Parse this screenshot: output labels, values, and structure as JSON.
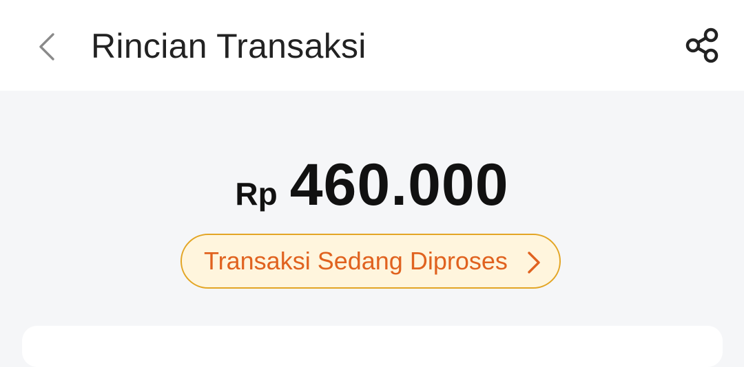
{
  "header": {
    "title": "Rincian Transaksi",
    "back_icon": "chevron-left-icon",
    "share_icon": "share-icon"
  },
  "summary": {
    "currency": "Rp",
    "amount": "460.000"
  },
  "status": {
    "label": "Transaksi Sedang Diproses",
    "icon": "chevron-right-icon"
  },
  "colors": {
    "status_text": "#e0621f",
    "status_border": "#e3a524",
    "status_bg": "#fff5dd",
    "page_bg": "#f5f6f8"
  }
}
